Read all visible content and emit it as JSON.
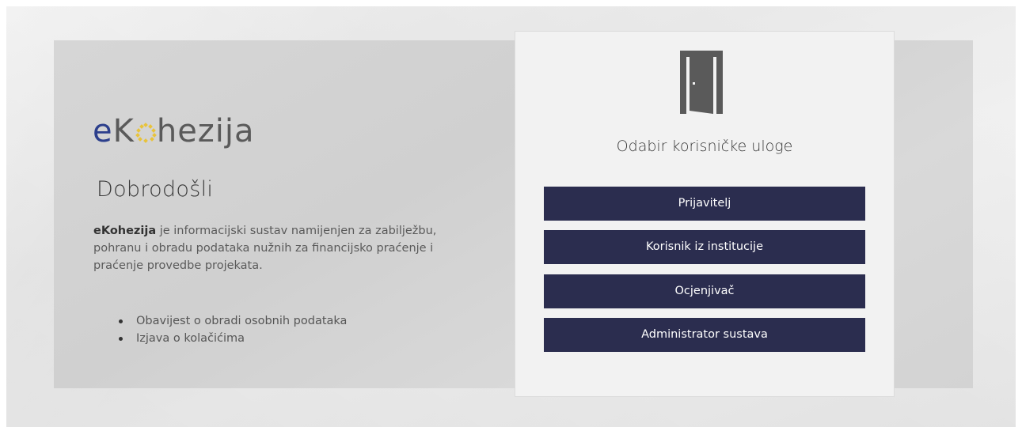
{
  "brand": {
    "logo_prefix": "e",
    "logo_k": "K",
    "logo_rest": "hezija",
    "logo_text": "eKohezija",
    "accent_color": "#2c3f8c",
    "stars_color": "#e8c33a"
  },
  "intro": {
    "welcome": "Dobrodošli",
    "description_bold": "eKohezija",
    "description_text": " je informacijski sustav namijenjen za zabilježbu, pohranu i obradu podataka nužnih za financijsko praćenje i praćenje provedbe projekata.",
    "links": [
      {
        "label": "Obavijest o obradi osobnih podataka"
      },
      {
        "label": "Izjava o kolačićima"
      }
    ]
  },
  "roles": {
    "icon": "door-open-icon",
    "title": "Odabir korisničke uloge",
    "button_color": "#2b2d4f",
    "options": [
      {
        "label": "Prijavitelj"
      },
      {
        "label": "Korisnik iz institucije"
      },
      {
        "label": "Ocjenjivač"
      },
      {
        "label": "Administrator sustava"
      }
    ]
  }
}
